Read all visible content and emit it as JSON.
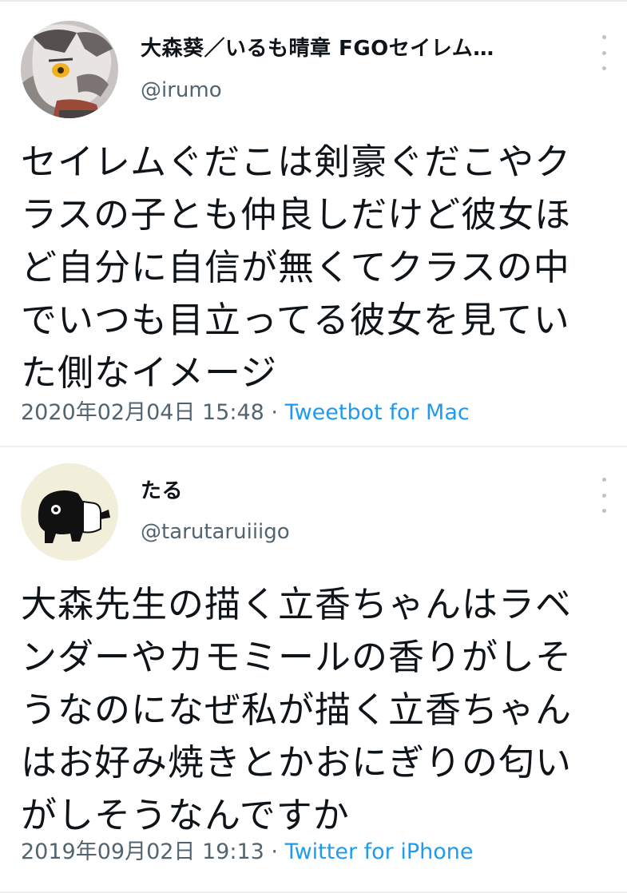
{
  "tweets": [
    {
      "display_name": "大森葵／いるも晴章 FGOセイレム…",
      "handle": "@irumo",
      "lines": [
        "セイレムぐだこは剣豪ぐだこやク",
        "ラスの子とも仲良しだけど彼女ほ",
        "ど自分に自信が無くてクラスの中",
        "でいつも目立ってる彼女を見てい",
        "た側なイメージ"
      ],
      "timestamp": "2020年02月04日 15:48",
      "separator": " · ",
      "source": "Tweetbot for Mac",
      "avatar_icon": "character-portrait-icon"
    },
    {
      "display_name": "たる",
      "handle": "@tarutaruiiigo",
      "lines": [
        "大森先生の描く立香ちゃんはラベ",
        "ンダーやカモミールの香りがしそ",
        "うなのになぜ私が描く立香ちゃん",
        "はお好み焼きとかおにぎりの匂い",
        "がしそうなんですか"
      ],
      "timestamp": "2019年09月02日 19:13",
      "separator": " · ",
      "source": "Twitter for iPhone",
      "avatar_icon": "tapir-icon"
    }
  ],
  "colors": {
    "text": "#0f1419",
    "secondary": "#536471",
    "link": "#1d9bf0",
    "divider": "#eef1f3"
  }
}
